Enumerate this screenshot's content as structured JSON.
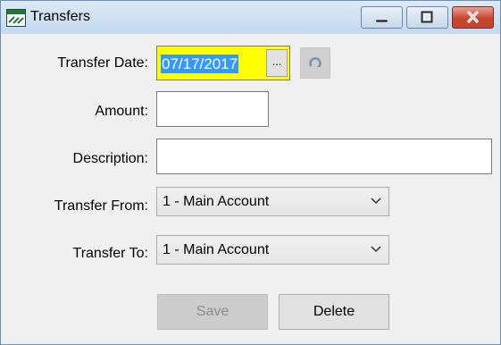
{
  "window": {
    "title": "Transfers"
  },
  "form": {
    "transfer_date": {
      "label": "Transfer Date:",
      "value": "07/17/2017",
      "picker_label": "..."
    },
    "amount": {
      "label": "Amount:",
      "value": ""
    },
    "description": {
      "label": "Description:",
      "value": ""
    },
    "transfer_from": {
      "label": "Transfer From:",
      "selected": "1 - Main Account"
    },
    "transfer_to": {
      "label": "Transfer To:",
      "selected": "1 - Main Account"
    }
  },
  "buttons": {
    "save": "Save",
    "delete": "Delete"
  },
  "colors": {
    "date_highlight": "#ffff00",
    "selection": "#3399ff",
    "close_button": "#c9452f"
  }
}
